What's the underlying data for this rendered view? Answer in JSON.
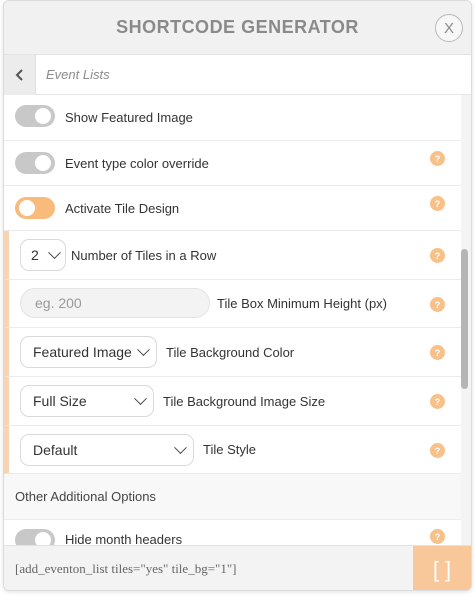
{
  "header": {
    "title": "SHORTCODE GENERATOR",
    "close_label": "X"
  },
  "subheader": {
    "back_icon": "chevron-left-icon",
    "title": "Event Lists"
  },
  "help_glyph": "?",
  "rows": {
    "featured_image": {
      "label": "Show Featured Image",
      "on": false
    },
    "event_type_color": {
      "label": "Event type color override",
      "on": false
    },
    "tile_design": {
      "label": "Activate Tile Design",
      "on": true
    },
    "tiles_in_row": {
      "value": "2",
      "label": "Number of Tiles in a Row"
    },
    "tile_min_height": {
      "placeholder": "eg. 200",
      "label": "Tile Box Minimum Height (px)"
    },
    "tile_bg_color": {
      "value": "Featured Image",
      "label": "Tile Background Color"
    },
    "tile_bg_size": {
      "value": "Full Size",
      "label": "Tile Background Image Size"
    },
    "tile_style": {
      "value": "Default",
      "label": "Tile Style"
    },
    "other_options": {
      "label": "Other Additional Options"
    },
    "hide_month_headers": {
      "label": "Hide month headers",
      "on": false
    }
  },
  "footer": {
    "shortcode": "[add_eventon_list tiles=\"yes\" tile_bg=\"1\"]",
    "copy_label": "[ ]"
  },
  "colors": {
    "accent": "#f8bb7b",
    "toggle_off": "#c8c8c8",
    "help": "#f8c189",
    "indent_bar": "#f7d5b4"
  }
}
